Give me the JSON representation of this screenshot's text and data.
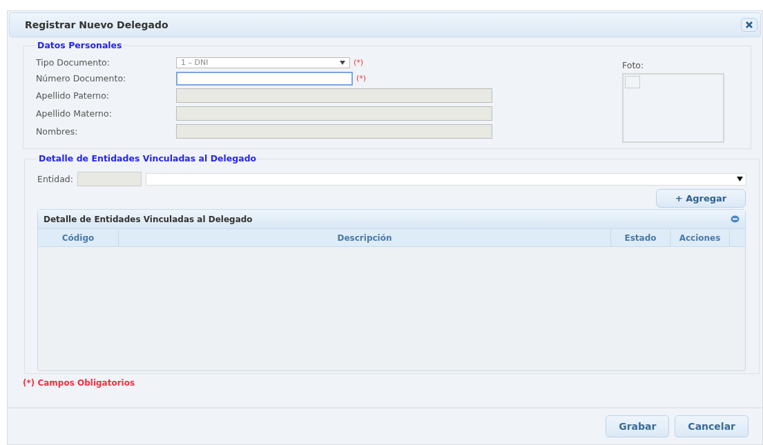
{
  "window": {
    "title": "Registrar Nuevo Delegado"
  },
  "personal": {
    "legend": "Datos Personales",
    "photo_label": "Foto:",
    "fields": [
      {
        "label": "Tipo Documento:",
        "kind": "select",
        "value": "1 – DNI",
        "required_mark": "(*)",
        "disabled": false,
        "focused": false
      },
      {
        "label": "Número Documento:",
        "kind": "text",
        "required_mark": "(*)",
        "disabled": false,
        "focused": true
      },
      {
        "label": "Apellido Paterno:",
        "kind": "text",
        "disabled": true,
        "focused": false
      },
      {
        "label": "Apellido Materno:",
        "kind": "text",
        "disabled": true,
        "focused": false
      },
      {
        "label": "Nombres:",
        "kind": "text",
        "disabled": true,
        "focused": false
      }
    ]
  },
  "entities": {
    "legend": "Detalle de Entidades Vinculadas al Delegado",
    "entity_label": "Entidad:",
    "add_button": "+ Agregar",
    "grid": {
      "title": "Detalle de Entidades Vinculadas al Delegado",
      "columns": [
        "Código",
        "Descripción",
        "Estado",
        "Acciones"
      ]
    }
  },
  "required_note": "(*) Campos Obligatorios",
  "buttons": [
    "Grabar",
    "Cancelar"
  ]
}
